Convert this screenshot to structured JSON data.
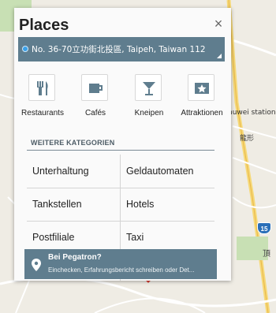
{
  "dialog": {
    "title": "Places",
    "close_symbol": "×",
    "location": "No. 36-70立功街北投區, Taipeh, Taiwan 112"
  },
  "categories": [
    {
      "label": "Restaurants",
      "icon": "fork-knife-icon"
    },
    {
      "label": "Cafés",
      "icon": "coffee-cup-icon"
    },
    {
      "label": "Kneipen",
      "icon": "cocktail-glass-icon"
    },
    {
      "label": "Attraktionen",
      "icon": "star-ticket-icon"
    }
  ],
  "more_categories": {
    "header": "WEITERE KATEGORIEN",
    "items": [
      "Unterhaltung",
      "Geldautomaten",
      "Tankstellen",
      "Hotels",
      "Postfiliale",
      "Taxi"
    ]
  },
  "checkin": {
    "title": "Bei Pegatron?",
    "subtitle": "Einchecken, Erfahrungsbericht schreiben oder Det..."
  },
  "map": {
    "station_label": "huwei station",
    "cjk_label": "龍形",
    "cjk_label2": "頂",
    "route_number": "15"
  },
  "colors": {
    "accent_bar": "#5f7d8e",
    "dialog_bg": "#fafafa",
    "map_bg": "#efece4"
  }
}
